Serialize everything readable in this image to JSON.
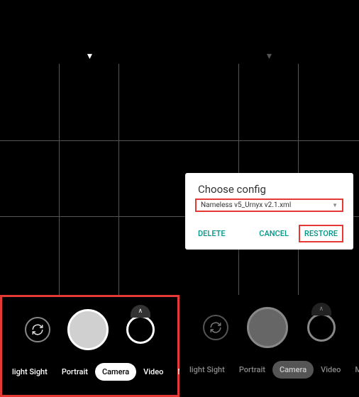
{
  "left": {
    "modes": {
      "night": "light Sight",
      "portrait": "Portrait",
      "camera": "Camera",
      "video": "Video",
      "more": "More"
    }
  },
  "right": {
    "modes": {
      "night": "light Sight",
      "portrait": "Portrait",
      "camera": "Camera",
      "video": "Video",
      "more": "More"
    },
    "dialog": {
      "title": "Choose config",
      "selected": "Nameless v5_Urnyx v2.1.xml",
      "delete": "DELETE",
      "cancel": "CANCEL",
      "restore": "RESTORE"
    }
  }
}
